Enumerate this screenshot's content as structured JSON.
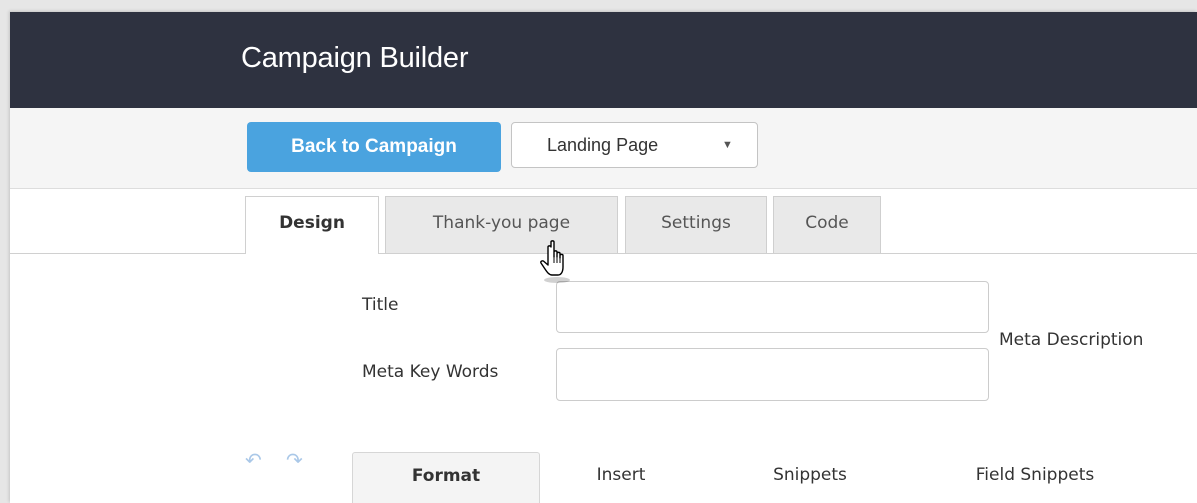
{
  "header": {
    "title": "Campaign Builder"
  },
  "toolbar": {
    "back_button": "Back to Campaign",
    "page_select": {
      "value": "Landing Page",
      "caret": "▼"
    }
  },
  "tabs": [
    {
      "label": "Design",
      "active": true
    },
    {
      "label": "Thank-you page",
      "active": false
    },
    {
      "label": "Settings",
      "active": false
    },
    {
      "label": "Code",
      "active": false
    }
  ],
  "form": {
    "title_label": "Title",
    "title_value": "",
    "meta_keywords_label": "Meta Key Words",
    "meta_keywords_value": "",
    "meta_description_label": "Meta Description"
  },
  "editor": {
    "undo_icon": "↶",
    "redo_icon": "↷",
    "tabs": [
      {
        "label": "Format",
        "active": true
      },
      {
        "label": "Insert",
        "active": false
      },
      {
        "label": "Snippets",
        "active": false
      },
      {
        "label": "Field Snippets",
        "active": false
      }
    ]
  },
  "colors": {
    "header_bg": "#2e3240",
    "primary_button": "#4aa3df",
    "toolbar_bg": "#f5f5f5"
  },
  "cursor_icon": "hand-pointer-icon"
}
